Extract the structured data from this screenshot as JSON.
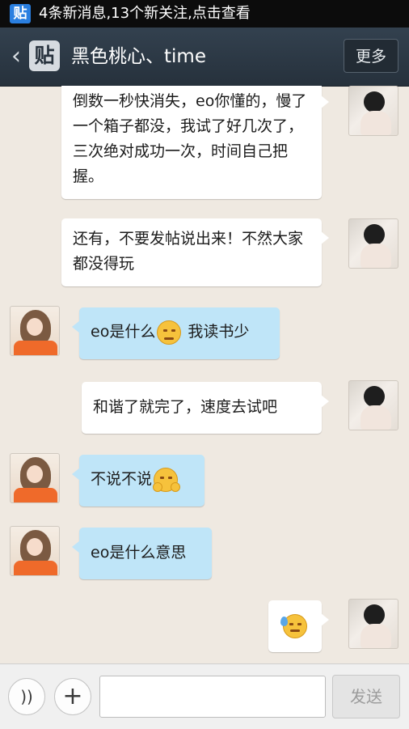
{
  "status_bar": {
    "app_icon_text": "贴",
    "notification": "4条新消息,13个新关注,点击查看"
  },
  "header": {
    "back_icon": "chevron-left-icon",
    "logo_text": "贴",
    "title": "黑色桃心、time",
    "more_label": "更多"
  },
  "messages": [
    {
      "side": "right",
      "text": "倒数一秒快消失，eo你懂的，慢了一个箱子都没，我试了好几次了，三次绝对成功一次，时间自己把握。"
    },
    {
      "side": "right",
      "text": "还有，不要发帖说出来！不然大家都没得玩"
    },
    {
      "side": "left",
      "text": "eo是什么",
      "emoji": "frown-face-icon",
      "text_after": " 我读书少"
    },
    {
      "side": "right",
      "text": "和谐了就完了，速度去试吧"
    },
    {
      "side": "left",
      "text": "不说不说",
      "emoji": "hands-face-icon"
    },
    {
      "side": "left",
      "text": "eo是什么意思"
    },
    {
      "side": "right",
      "text": "",
      "emoji": "sweat-face-icon"
    }
  ],
  "input_bar": {
    "voice_icon": "voice-icon",
    "plus_icon": "plus-icon",
    "input_value": "",
    "input_placeholder": "",
    "send_label": "发送"
  },
  "colors": {
    "background": "#efe9e1",
    "left_bubble": "#bfe5f8",
    "right_bubble": "#ffffff",
    "header": "#2b3744"
  }
}
